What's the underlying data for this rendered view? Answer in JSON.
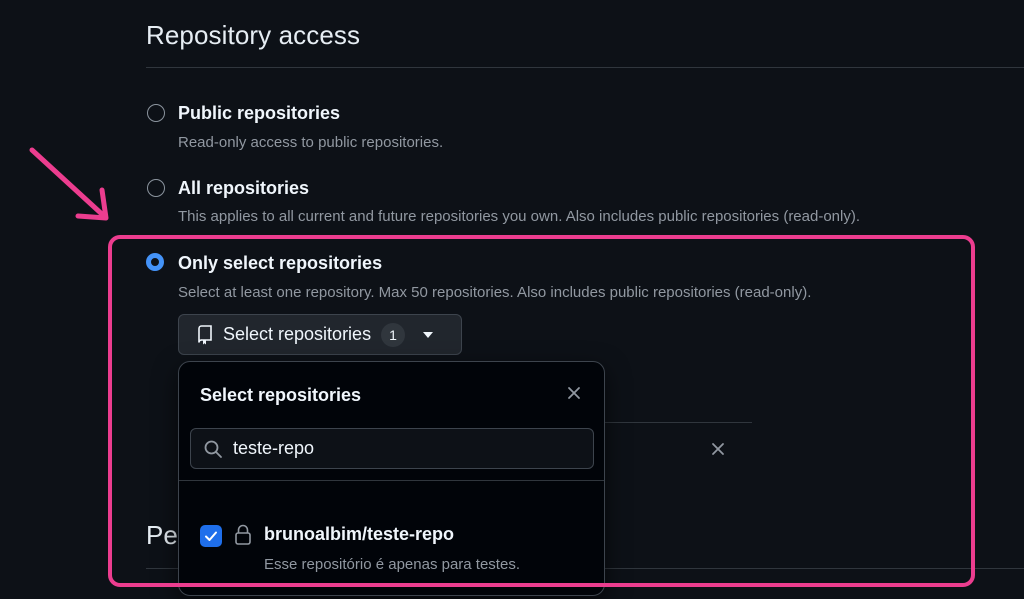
{
  "section": {
    "title": "Repository access"
  },
  "options": [
    {
      "label": "Public repositories",
      "description": "Read-only access to public repositories.",
      "checked": false
    },
    {
      "label": "All repositories",
      "description": "This applies to all current and future repositories you own. Also includes public repositories (read-only).",
      "checked": false
    },
    {
      "label": "Only select repositories",
      "description": "Select at least one repository. Max 50 repositories. Also includes public repositories (read-only).",
      "checked": true
    }
  ],
  "select_button": {
    "label": "Select repositories",
    "count": "1"
  },
  "popover": {
    "title": "Select repositories",
    "search_value": "teste-repo",
    "items": [
      {
        "name": "brunoalbim/teste-repo",
        "description": "Esse repositório é apenas para testes.",
        "checked": true
      }
    ]
  },
  "background": {
    "partial_heading": "Pe"
  },
  "colors": {
    "accent": "#4493f8",
    "checkbox": "#1f6feb",
    "highlight": "#ec3d8f",
    "background": "#0d1117"
  },
  "icons": [
    "repo-icon",
    "caret-down-icon",
    "close-icon",
    "search-icon",
    "check-icon",
    "lock-icon",
    "annotation-arrow-icon"
  ]
}
